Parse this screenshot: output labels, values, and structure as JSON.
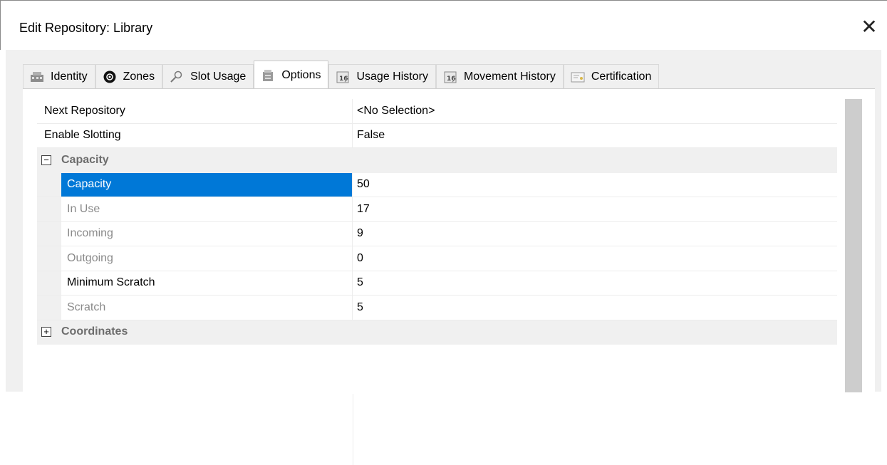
{
  "window": {
    "title": "Edit Repository: Library",
    "close_glyph": "✕"
  },
  "tabs": [
    {
      "label": "Identity",
      "icon": "identity-icon"
    },
    {
      "label": "Zones",
      "icon": "zones-icon"
    },
    {
      "label": "Slot Usage",
      "icon": "magnifier-icon"
    },
    {
      "label": "Options",
      "icon": "options-icon",
      "active": true
    },
    {
      "label": "Usage History",
      "icon": "calendar-icon"
    },
    {
      "label": "Movement History",
      "icon": "calendar-icon"
    },
    {
      "label": "Certification",
      "icon": "certificate-icon"
    }
  ],
  "properties": {
    "next_repository": {
      "name": "Next Repository",
      "value": "<No Selection>"
    },
    "enable_slotting": {
      "name": "Enable Slotting",
      "value": "False"
    },
    "capacity_category": {
      "name": "Capacity",
      "expander": "⊟"
    },
    "capacity": {
      "name": "Capacity",
      "value": "50"
    },
    "in_use": {
      "name": "In Use",
      "value": "17"
    },
    "incoming": {
      "name": "Incoming",
      "value": "9"
    },
    "outgoing": {
      "name": "Outgoing",
      "value": "0"
    },
    "minimum_scratch": {
      "name": "Minimum Scratch",
      "value": "5"
    },
    "scratch": {
      "name": "Scratch",
      "value": "5"
    },
    "coordinates_category": {
      "name": "Coordinates",
      "expander": "⊞"
    }
  },
  "colors": {
    "selection": "#0078d7",
    "category_bg": "#f0f0f0",
    "readonly_text": "#8a8a8a"
  }
}
